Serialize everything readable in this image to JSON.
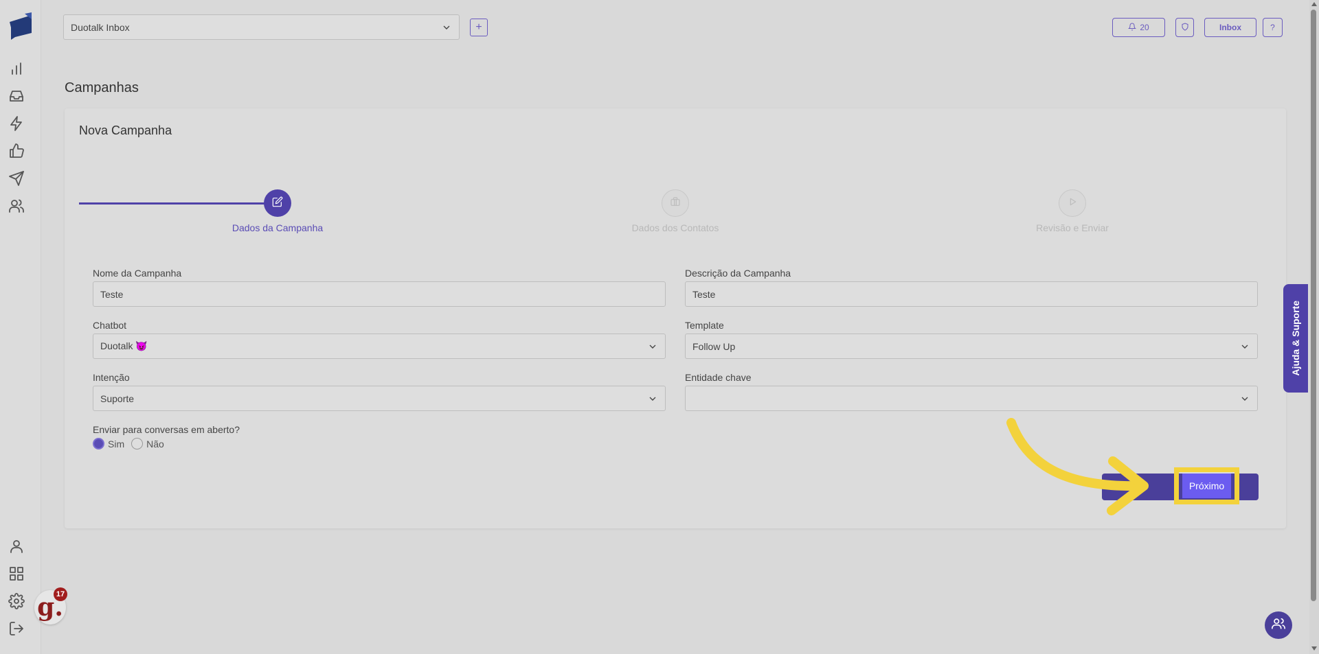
{
  "header": {
    "inbox_select_value": "Duotalk Inbox",
    "add_label": "+",
    "notifications_count": "20",
    "inbox_label": "Inbox",
    "help_label": "?"
  },
  "page": {
    "title": "Campanhas",
    "card_title": "Nova Campanha"
  },
  "stepper": {
    "steps": [
      {
        "label": "Dados da Campanha",
        "state": "active",
        "icon": "edit-icon"
      },
      {
        "label": "Dados dos Contatos",
        "state": "inactive",
        "icon": "briefcase-icon"
      },
      {
        "label": "Revisão e Enviar",
        "state": "inactive",
        "icon": "play-icon"
      }
    ]
  },
  "form": {
    "nome_label": "Nome da Campanha",
    "nome_value": "Teste",
    "descricao_label": "Descrição da Campanha",
    "descricao_value": "Teste",
    "chatbot_label": "Chatbot",
    "chatbot_value": "Duotalk 😈",
    "template_label": "Template",
    "template_value": "Follow Up",
    "intencao_label": "Intenção",
    "intencao_value": "Suporte",
    "entidade_label": "Entidade chave",
    "entidade_value": "",
    "open_question": "Enviar para conversas em aberto?",
    "option_sim": "Sim",
    "option_nao": "Não",
    "selected": "Sim"
  },
  "actions": {
    "next_label": "Próximo"
  },
  "help_tab": {
    "label": "Ajuda & Suporte"
  },
  "widget": {
    "letter": "g.",
    "count": "17"
  },
  "colors": {
    "accent": "#4f41a8",
    "highlight": "#f3d23c",
    "next_button": "#6b5cf0"
  }
}
